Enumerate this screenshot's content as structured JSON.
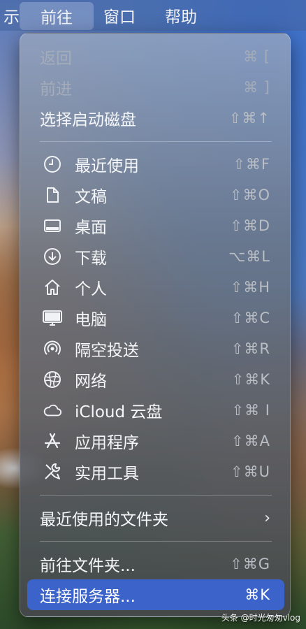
{
  "menubar": {
    "items": [
      {
        "label": "示"
      },
      {
        "label": "前往"
      },
      {
        "label": "窗口"
      },
      {
        "label": "帮助"
      }
    ]
  },
  "menu": {
    "items": [
      {
        "label": "返回",
        "shortcut": "⌘ [",
        "disabled": true
      },
      {
        "label": "前进",
        "shortcut": "⌘ ]",
        "disabled": true
      },
      {
        "label": "选择启动磁盘",
        "shortcut": "⇧⌘↑"
      },
      {
        "label": "最近使用",
        "shortcut": "⇧⌘F",
        "icon": "clock-icon"
      },
      {
        "label": "文稿",
        "shortcut": "⇧⌘O",
        "icon": "document-icon"
      },
      {
        "label": "桌面",
        "shortcut": "⇧⌘D",
        "icon": "desktop-icon"
      },
      {
        "label": "下载",
        "shortcut": "⌥⌘L",
        "icon": "download-icon"
      },
      {
        "label": "个人",
        "shortcut": "⇧⌘H",
        "icon": "home-icon"
      },
      {
        "label": "电脑",
        "shortcut": "⇧⌘C",
        "icon": "computer-icon"
      },
      {
        "label": "隔空投送",
        "shortcut": "⇧⌘R",
        "icon": "airdrop-icon"
      },
      {
        "label": "网络",
        "shortcut": "⇧⌘K",
        "icon": "network-icon"
      },
      {
        "label": "iCloud 云盘",
        "shortcut": "⇧⌘ I",
        "icon": "cloud-icon"
      },
      {
        "label": "应用程序",
        "shortcut": "⇧⌘A",
        "icon": "applications-icon"
      },
      {
        "label": "实用工具",
        "shortcut": "⇧⌘U",
        "icon": "utilities-icon"
      },
      {
        "label": "最近使用的文件夹",
        "submenu_indicator": "›"
      },
      {
        "label": "前往文件夹...",
        "shortcut": "⇧⌘G"
      },
      {
        "label": "连接服务器...",
        "shortcut": "⌘K",
        "selected": true
      }
    ]
  },
  "watermark": "头条 @时光匆匆vlog",
  "colors": {
    "highlight": "#3b63c9",
    "menu_text": "#f5f6f8",
    "shortcut_text": "#b9bdc4",
    "disabled_text": "#a5acb9"
  }
}
